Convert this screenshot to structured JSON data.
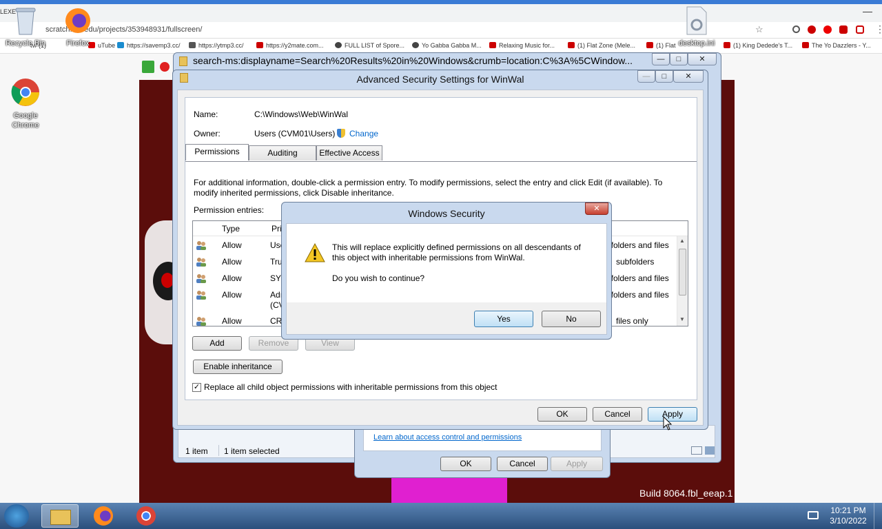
{
  "browser": {
    "url": "scratch.mit.edu/projects/353948931/fullscreen/",
    "url_fragment": "tv/ (1)",
    "bookmarks": [
      {
        "label": "uTube",
        "color": "#d00"
      },
      {
        "label": "https://savemp3.cc/",
        "color": "#1a8ccf"
      },
      {
        "label": "https://ytmp3.cc/",
        "color": "#555"
      },
      {
        "label": "https://y2mate.com...",
        "color": "#c00"
      },
      {
        "label": "FULL LIST of Spore...",
        "color": "#444"
      },
      {
        "label": "Yo Gabba Gabba M...",
        "color": "#444"
      },
      {
        "label": "Relaxing Music for...",
        "color": "#c00"
      },
      {
        "label": "(1) Flat Zone (Mele...",
        "color": "#c00"
      },
      {
        "label": "(1) Flat",
        "color": "#c00"
      },
      {
        "label": "(1) King Dedede's T...",
        "color": "#c00"
      },
      {
        "label": "The Yo Dazzlers - Y...",
        "color": "#c00"
      }
    ]
  },
  "desktop": {
    "recycle_bin": "Recycle Bin",
    "firefox": "Firefox",
    "chrome": "Google Chrome",
    "desktop_ini": "desktop.ini",
    "exe_label": "LEXE"
  },
  "stage": {
    "build": "Build 8064.fbl_eeap.1"
  },
  "explorer": {
    "title": "search-ms:displayname=Search%20Results%20in%20Windows&crumb=location:C%3A%5CWindow...",
    "status_items": "1 item",
    "status_selected": "1 item selected"
  },
  "props_dialog": {
    "link": "Learn about access control and permissions",
    "ok": "OK",
    "cancel": "Cancel",
    "apply": "Apply"
  },
  "adv": {
    "title": "Advanced Security Settings for WinWal",
    "name_label": "Name:",
    "name_value": "C:\\Windows\\Web\\WinWal",
    "owner_label": "Owner:",
    "owner_value": "Users (CVM01\\Users)",
    "change_link": "Change",
    "tabs": [
      "Permissions",
      "Auditing",
      "Effective Access"
    ],
    "info_line1": "For additional information, double-click a permission entry. To modify permissions, select the entry and click Edit (if available). To",
    "info_line2": "modify inherited permissions, click Disable inheritance.",
    "entries_label": "Permission entries:",
    "col_type": "Type",
    "col_principal": "Pri",
    "rows": [
      {
        "type": "Allow",
        "principal": "Use",
        "applies": "bfolders and files"
      },
      {
        "type": "Allow",
        "principal": "Tru",
        "applies": "subfolders"
      },
      {
        "type": "Allow",
        "principal": "SYS",
        "applies": "bfolders and files"
      },
      {
        "type": "Allow",
        "principal": "Adı",
        "principal2": "(CVI",
        "applies": "bfolders and files"
      },
      {
        "type": "Allow",
        "principal": "CRE",
        "applies": "files only"
      }
    ],
    "add": "Add",
    "remove": "Remove",
    "view": "View",
    "enable_inheritance": "Enable inheritance",
    "replace_checkbox": "Replace all child object permissions with inheritable permissions from this object",
    "ok": "OK",
    "cancel": "Cancel",
    "apply": "Apply"
  },
  "security": {
    "title": "Windows Security",
    "message_line1": "This will replace explicitly defined permissions on all descendants of",
    "message_line2": "this object with inheritable permissions from WinWal.",
    "question": "Do you wish to continue?",
    "yes": "Yes",
    "no": "No"
  },
  "taskbar": {
    "time": "10:21 PM",
    "date": "3/10/2022"
  },
  "colors": {
    "link": "#0066cc",
    "stage_bg": "#5b0d0b",
    "taskbar": "#2b4f7c"
  }
}
